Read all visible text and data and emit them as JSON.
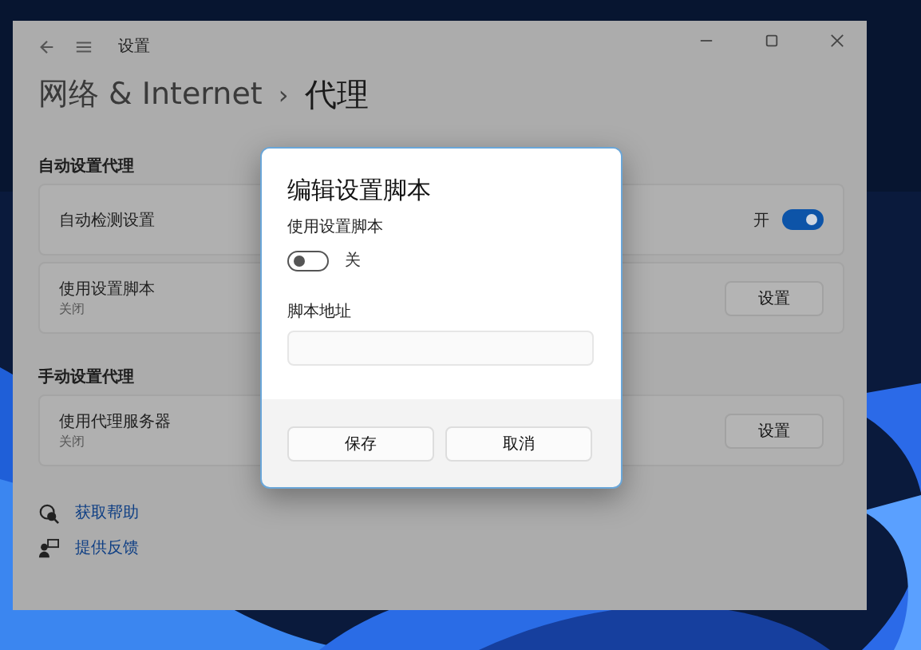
{
  "window": {
    "title": "设置"
  },
  "breadcrumb": {
    "parent": "网络 & Internet",
    "separator": "›",
    "current": "代理"
  },
  "sections": [
    {
      "heading": "自动设置代理",
      "items": [
        {
          "kind": "toggle",
          "title": "自动检测设置",
          "on": true,
          "state_label": "开"
        },
        {
          "kind": "button",
          "title": "使用设置脚本",
          "subtitle": "关闭",
          "button": "设置"
        }
      ]
    },
    {
      "heading": "手动设置代理",
      "items": [
        {
          "kind": "button",
          "title": "使用代理服务器",
          "subtitle": "关闭",
          "button": "设置"
        }
      ]
    }
  ],
  "links": [
    {
      "kind": "help",
      "label": "获取帮助"
    },
    {
      "kind": "feedback",
      "label": "提供反馈"
    }
  ],
  "dialog": {
    "title": "编辑设置脚本",
    "toggle_label": "使用设置脚本",
    "toggle_on": false,
    "state_label": "关",
    "field_label": "脚本地址",
    "buttons": [
      "保存",
      "取消"
    ]
  }
}
